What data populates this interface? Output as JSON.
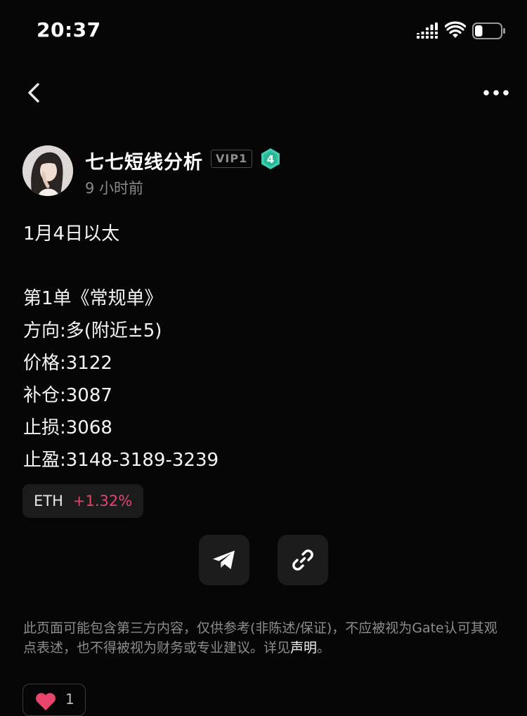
{
  "status_bar": {
    "time": "20:37",
    "icons": [
      "signal-icon",
      "wifi-icon",
      "battery-icon"
    ],
    "battery_level": 0.3
  },
  "nav": {
    "icons": [
      "back-icon",
      "more-icon"
    ]
  },
  "author": {
    "name": "七七短线分析",
    "vip": "VIP1",
    "level": "4",
    "posted": "9 小时前"
  },
  "post": {
    "lines": [
      "1月4日以太",
      "",
      "第1单《常规单》",
      "方向:多(附近±5)",
      "价格:3122",
      "补仓:3087",
      "止损:3068",
      "止盈:3148-3189-3239"
    ]
  },
  "ticker": {
    "symbol": "ETH",
    "change": "+1.32%"
  },
  "share": {
    "icons": [
      "telegram-icon",
      "link-icon"
    ]
  },
  "disclaimer": {
    "text": "此页面可能包含第三方内容，仅供参考(非陈述/保证)，不应被视为Gate认可其观点表述，也不得被视为财务或专业建议。详见",
    "link": "声明",
    "end": "。"
  },
  "reactions": {
    "likes": "1"
  },
  "colors": {
    "background": "#060606",
    "positive_change": "#e0476d",
    "level_badge": "#3ccfb0",
    "heart": "#e8456c"
  }
}
